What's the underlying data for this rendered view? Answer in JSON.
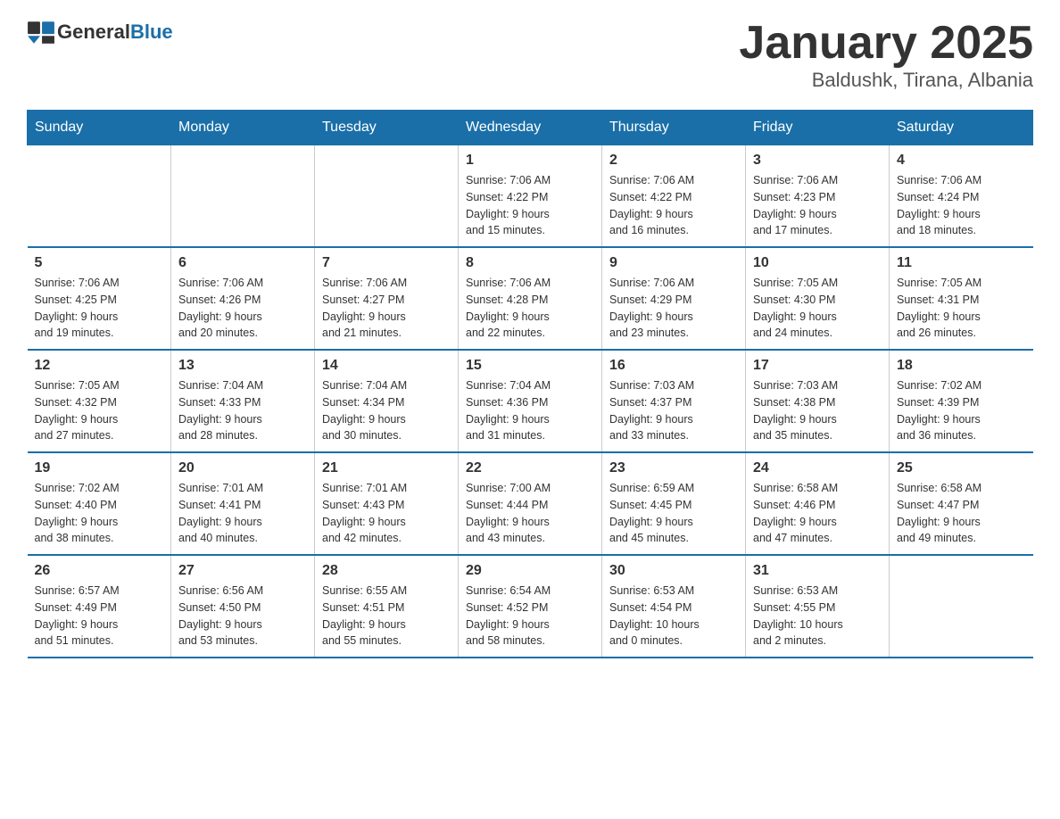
{
  "header": {
    "logo_text_general": "General",
    "logo_text_blue": "Blue",
    "month_title": "January 2025",
    "location": "Baldushk, Tirana, Albania"
  },
  "days_of_week": [
    "Sunday",
    "Monday",
    "Tuesday",
    "Wednesday",
    "Thursday",
    "Friday",
    "Saturday"
  ],
  "weeks": [
    [
      {
        "day": "",
        "info": ""
      },
      {
        "day": "",
        "info": ""
      },
      {
        "day": "",
        "info": ""
      },
      {
        "day": "1",
        "info": "Sunrise: 7:06 AM\nSunset: 4:22 PM\nDaylight: 9 hours\nand 15 minutes."
      },
      {
        "day": "2",
        "info": "Sunrise: 7:06 AM\nSunset: 4:22 PM\nDaylight: 9 hours\nand 16 minutes."
      },
      {
        "day": "3",
        "info": "Sunrise: 7:06 AM\nSunset: 4:23 PM\nDaylight: 9 hours\nand 17 minutes."
      },
      {
        "day": "4",
        "info": "Sunrise: 7:06 AM\nSunset: 4:24 PM\nDaylight: 9 hours\nand 18 minutes."
      }
    ],
    [
      {
        "day": "5",
        "info": "Sunrise: 7:06 AM\nSunset: 4:25 PM\nDaylight: 9 hours\nand 19 minutes."
      },
      {
        "day": "6",
        "info": "Sunrise: 7:06 AM\nSunset: 4:26 PM\nDaylight: 9 hours\nand 20 minutes."
      },
      {
        "day": "7",
        "info": "Sunrise: 7:06 AM\nSunset: 4:27 PM\nDaylight: 9 hours\nand 21 minutes."
      },
      {
        "day": "8",
        "info": "Sunrise: 7:06 AM\nSunset: 4:28 PM\nDaylight: 9 hours\nand 22 minutes."
      },
      {
        "day": "9",
        "info": "Sunrise: 7:06 AM\nSunset: 4:29 PM\nDaylight: 9 hours\nand 23 minutes."
      },
      {
        "day": "10",
        "info": "Sunrise: 7:05 AM\nSunset: 4:30 PM\nDaylight: 9 hours\nand 24 minutes."
      },
      {
        "day": "11",
        "info": "Sunrise: 7:05 AM\nSunset: 4:31 PM\nDaylight: 9 hours\nand 26 minutes."
      }
    ],
    [
      {
        "day": "12",
        "info": "Sunrise: 7:05 AM\nSunset: 4:32 PM\nDaylight: 9 hours\nand 27 minutes."
      },
      {
        "day": "13",
        "info": "Sunrise: 7:04 AM\nSunset: 4:33 PM\nDaylight: 9 hours\nand 28 minutes."
      },
      {
        "day": "14",
        "info": "Sunrise: 7:04 AM\nSunset: 4:34 PM\nDaylight: 9 hours\nand 30 minutes."
      },
      {
        "day": "15",
        "info": "Sunrise: 7:04 AM\nSunset: 4:36 PM\nDaylight: 9 hours\nand 31 minutes."
      },
      {
        "day": "16",
        "info": "Sunrise: 7:03 AM\nSunset: 4:37 PM\nDaylight: 9 hours\nand 33 minutes."
      },
      {
        "day": "17",
        "info": "Sunrise: 7:03 AM\nSunset: 4:38 PM\nDaylight: 9 hours\nand 35 minutes."
      },
      {
        "day": "18",
        "info": "Sunrise: 7:02 AM\nSunset: 4:39 PM\nDaylight: 9 hours\nand 36 minutes."
      }
    ],
    [
      {
        "day": "19",
        "info": "Sunrise: 7:02 AM\nSunset: 4:40 PM\nDaylight: 9 hours\nand 38 minutes."
      },
      {
        "day": "20",
        "info": "Sunrise: 7:01 AM\nSunset: 4:41 PM\nDaylight: 9 hours\nand 40 minutes."
      },
      {
        "day": "21",
        "info": "Sunrise: 7:01 AM\nSunset: 4:43 PM\nDaylight: 9 hours\nand 42 minutes."
      },
      {
        "day": "22",
        "info": "Sunrise: 7:00 AM\nSunset: 4:44 PM\nDaylight: 9 hours\nand 43 minutes."
      },
      {
        "day": "23",
        "info": "Sunrise: 6:59 AM\nSunset: 4:45 PM\nDaylight: 9 hours\nand 45 minutes."
      },
      {
        "day": "24",
        "info": "Sunrise: 6:58 AM\nSunset: 4:46 PM\nDaylight: 9 hours\nand 47 minutes."
      },
      {
        "day": "25",
        "info": "Sunrise: 6:58 AM\nSunset: 4:47 PM\nDaylight: 9 hours\nand 49 minutes."
      }
    ],
    [
      {
        "day": "26",
        "info": "Sunrise: 6:57 AM\nSunset: 4:49 PM\nDaylight: 9 hours\nand 51 minutes."
      },
      {
        "day": "27",
        "info": "Sunrise: 6:56 AM\nSunset: 4:50 PM\nDaylight: 9 hours\nand 53 minutes."
      },
      {
        "day": "28",
        "info": "Sunrise: 6:55 AM\nSunset: 4:51 PM\nDaylight: 9 hours\nand 55 minutes."
      },
      {
        "day": "29",
        "info": "Sunrise: 6:54 AM\nSunset: 4:52 PM\nDaylight: 9 hours\nand 58 minutes."
      },
      {
        "day": "30",
        "info": "Sunrise: 6:53 AM\nSunset: 4:54 PM\nDaylight: 10 hours\nand 0 minutes."
      },
      {
        "day": "31",
        "info": "Sunrise: 6:53 AM\nSunset: 4:55 PM\nDaylight: 10 hours\nand 2 minutes."
      },
      {
        "day": "",
        "info": ""
      }
    ]
  ]
}
